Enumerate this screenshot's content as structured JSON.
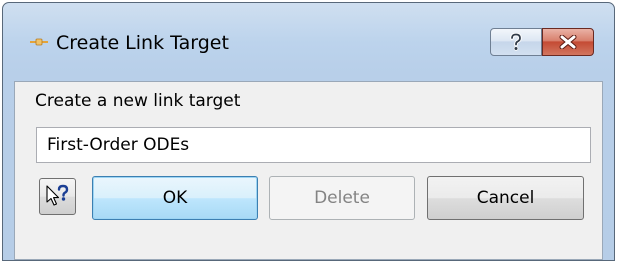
{
  "window": {
    "title": "Create Link Target",
    "icon": "link-anchor-icon"
  },
  "caption_buttons": {
    "help_icon": "question-icon",
    "close_icon": "close-x-icon"
  },
  "dialog": {
    "prompt": "Create a new link target",
    "input_value": "First-Order ODEs",
    "context_help_icon": "context-help-icon",
    "ok_label": "OK",
    "delete_label": "Delete",
    "cancel_label": "Cancel"
  },
  "colors": {
    "ok_border": "#3c7fb1",
    "close_button": "#c44b34",
    "disabled_text": "#838383"
  }
}
